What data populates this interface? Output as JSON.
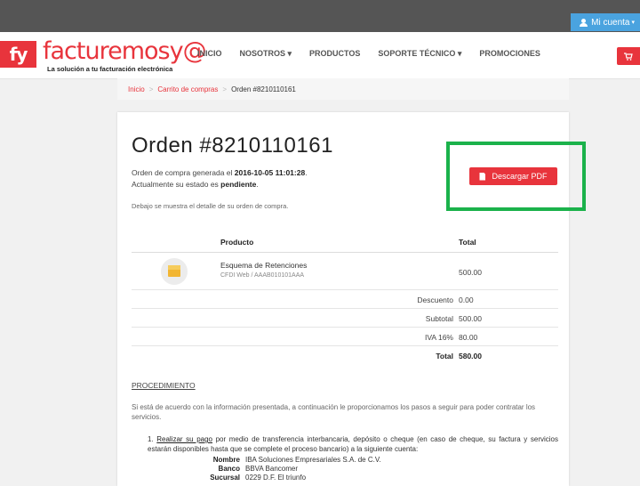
{
  "topbar": {
    "account_label": "Mi cuenta",
    "account_caret": "▾"
  },
  "brand": {
    "logo_mark": "fy",
    "logo_word": "facturemosy@",
    "tagline": "La solución a tu facturación electrónica",
    "accent": "#e8343c"
  },
  "nav": {
    "items": [
      {
        "label": "INICIO"
      },
      {
        "label": "NOSOTROS ▾"
      },
      {
        "label": "PRODUCTOS"
      },
      {
        "label": "SOPORTE TÉCNICO ▾"
      },
      {
        "label": "PROMOCIONES"
      }
    ],
    "cart_icon": "cart-icon"
  },
  "breadcrumb": {
    "home": "Inicio",
    "sep": ">",
    "cart": "Carrito de compras",
    "current": "Orden #8210110161"
  },
  "order": {
    "title": "Orden #8210110161",
    "generated_prefix": "Orden de compra generada el ",
    "generated_date": "2016-10-05 11:01:28",
    "generated_suffix": ".",
    "status_prefix": "Actualmente su estado es ",
    "status": "pendiente",
    "status_suffix": ".",
    "detail_note": "Debajo se muestra el detalle de su orden de compra.",
    "download_label": "Descargar PDF",
    "highlight_color": "#1bb24b"
  },
  "table": {
    "headers": {
      "product": "Producto",
      "total": "Total"
    },
    "item": {
      "name": "Esquema de Retenciones",
      "sub": "CFDI Web / AAAB010101AAA",
      "total": "500.00"
    },
    "summary": {
      "discount_label": "Descuento",
      "discount": "0.00",
      "subtotal_label": "Subtotal",
      "subtotal": "500.00",
      "iva_label": "IVA 16%",
      "iva": "80.00",
      "total_label": "Total",
      "total": "580.00"
    }
  },
  "procedure": {
    "title": "PROCEDIMIENTO",
    "intro": "Si está de acuerdo con la información presentada, a continuación le proporcionamos los pasos a seguir para poder contratar los servicios.",
    "step_num": "1.",
    "step_link": "Realizar su pago",
    "step_text": " por medio de transferencia interbancaria, depósito o cheque (en caso de cheque, su factura y servicios estarán disponibles hasta que se complete el proceso bancario) a la siguiente cuenta:",
    "bank": {
      "name_label": "Nombre",
      "name": "IBA Soluciones Empresariales S.A. de C.V.",
      "bank_label": "Banco",
      "bank": "BBVA Bancomer",
      "branch_label": "Sucursal",
      "branch": "0229 D.F. El triunfo"
    }
  }
}
